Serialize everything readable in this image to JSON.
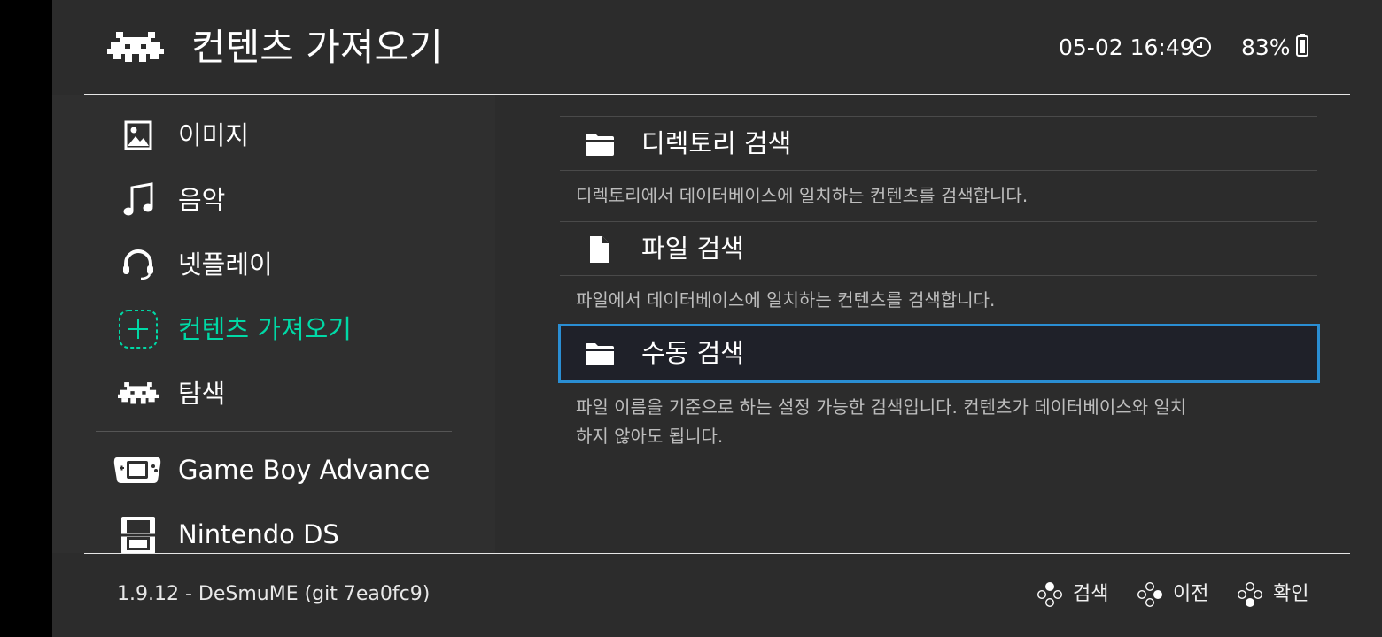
{
  "header": {
    "title": "컨텐츠 가져오기",
    "clock": "05-02 16:49",
    "battery": "83%"
  },
  "sidebar": {
    "items": [
      {
        "label": "이미지",
        "icon": "image-icon"
      },
      {
        "label": "음악",
        "icon": "music-note-icon"
      },
      {
        "label": "넷플레이",
        "icon": "headset-icon"
      },
      {
        "label": "컨텐츠 가져오기",
        "icon": "add-icon",
        "active": true
      },
      {
        "label": "탐색",
        "icon": "retroarch-invader-icon"
      }
    ],
    "systems": [
      {
        "label": "Game Boy Advance",
        "icon": "gba-icon"
      },
      {
        "label": "Nintendo DS",
        "icon": "nds-icon"
      }
    ]
  },
  "main": {
    "entries": [
      {
        "label": "디렉토리 검색",
        "icon": "folder-icon",
        "description": "디렉토리에서 데이터베이스에 일치하는 컨텐츠를 검색합니다."
      },
      {
        "label": "파일 검색",
        "icon": "file-icon",
        "description": "파일에서 데이터베이스에 일치하는 컨텐츠를 검색합니다."
      },
      {
        "label": "수동 검색",
        "icon": "folder-icon",
        "selected": true,
        "description_lines": [
          "파일 이름을 기준으로 하는 설정 가능한 검색입니다. 컨텐츠가 데이터베이스와 일치",
          "하지 않아도 됩니다."
        ]
      }
    ]
  },
  "footer": {
    "version": "1.9.12 - DeSmuME (git 7ea0fc9)",
    "hints": [
      {
        "label": "검색",
        "icon": "gamepad-button-top-icon"
      },
      {
        "label": "이전",
        "icon": "gamepad-button-right-icon"
      },
      {
        "label": "확인",
        "icon": "gamepad-button-bottom-icon"
      }
    ]
  },
  "colors": {
    "background": "#2c2c2c",
    "sidebar_bg": "#2f2f2f",
    "accent": "#00d9a6",
    "selection_border": "#2a8ed3",
    "selection_bg": "#1f2129"
  }
}
